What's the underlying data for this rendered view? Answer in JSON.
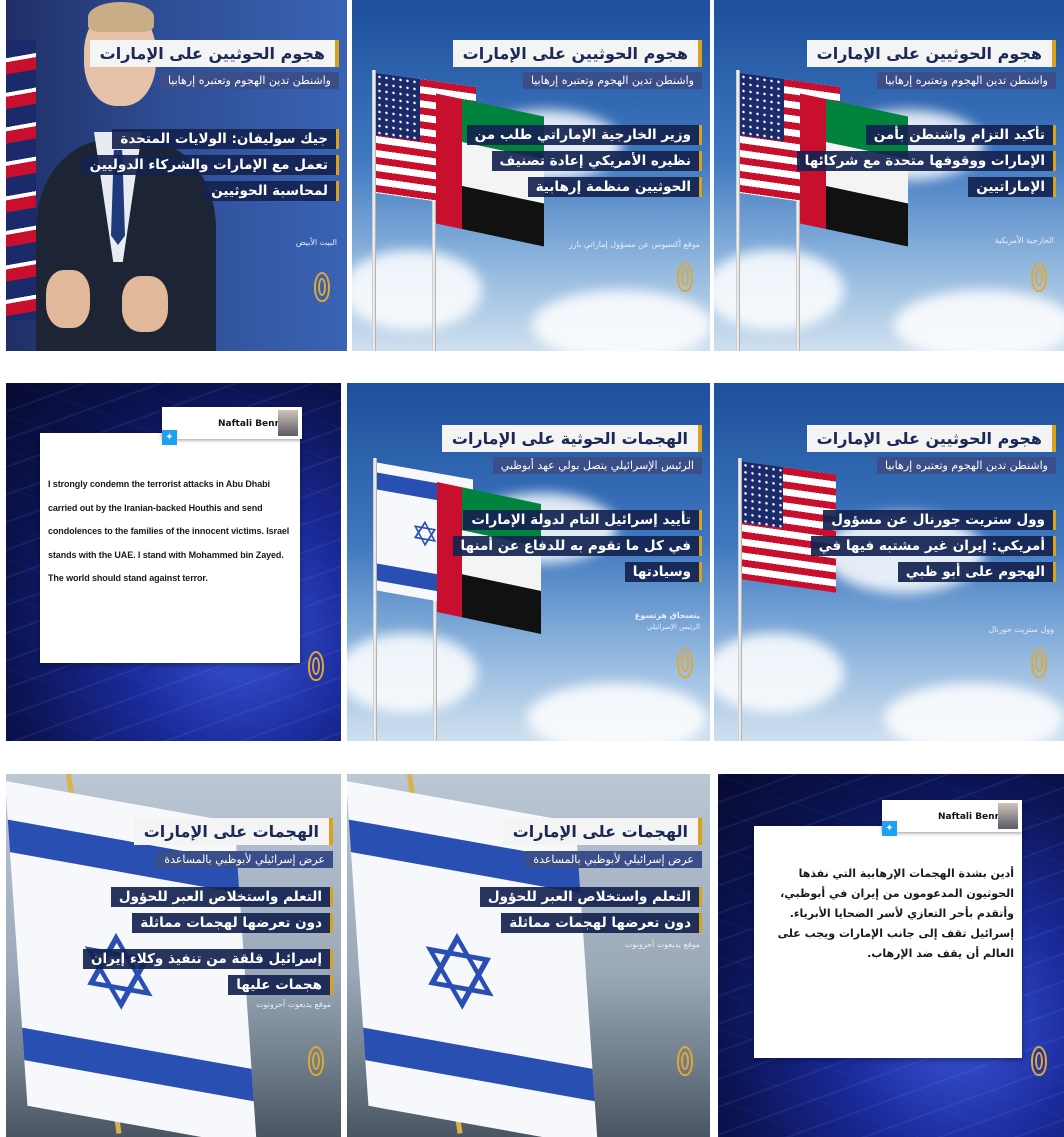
{
  "panels": [
    {
      "title": "هجوم الحوثيين على الإمارات",
      "subtitle": "واشنطن تدين الهجوم وتعتبره إرهابيا",
      "body": [
        "جيك سوليفان: الولايات المتحدة",
        "تعمل مع الإمارات والشركاء الدوليين",
        "لمحاسبة الحوثيين"
      ],
      "source": "البيت الأبيض"
    },
    {
      "title": "هجوم الحوثيين على الإمارات",
      "subtitle": "واشنطن تدين الهجوم وتعتبره إرهابيا",
      "body": [
        "وزير الخارجية الإماراتي طلب من",
        "نظيره الأمريكي إعادة تصنيف",
        "الحوثيين منظمة إرهابية"
      ],
      "source": "موقع أكسيوس عن مسؤول إماراتي بارز"
    },
    {
      "title": "هجوم الحوثيين على الإمارات",
      "subtitle": "واشنطن تدين الهجوم وتعتبره إرهابيا",
      "body": [
        "تأكيد التزام واشنطن بأمن",
        "الإمارات ووقوفها متحدة مع شركائها",
        "الإماراتيين"
      ],
      "source": "الخارجية الأمريكية"
    },
    {
      "tweet_name": "Naftali Bennett",
      "tweet_text": "I strongly condemn the terrorist attacks in Abu Dhabi carried out by the Iranian-backed Houthis and send condolences to the families of the innocent victims.   Israel stands with the UAE.  I stand with Mohammed bin Zayed. The world should stand against terror."
    },
    {
      "title": "الهجمات الحوثية على الإمارات",
      "subtitle": "الرئيس الإسرائيلي يتصل بولي عهد أبوظبي",
      "body": [
        "تأييد إسرائيل التام لدولة الإمارات",
        "في كل ما تقوم به للدفاع عن أمنها",
        "وسيادتها"
      ],
      "source": "يتسحاق هرتسوغ",
      "source2": "الرئيس الإسرائيلي"
    },
    {
      "title": "هجوم الحوثيين على الإمارات",
      "subtitle": "واشنطن تدين الهجوم وتعتبره إرهابيا",
      "body": [
        "وول ستريت جورنال عن مسؤول",
        "أمريكي: إيران غير مشتبه فيها في",
        "الهجوم على أبو ظبي"
      ],
      "source": "وول ستريت جورنال"
    },
    {
      "title": "الهجمات على الإمارات",
      "subtitle": "عرض إسرائيلي لأبوظبي بالمساعدة",
      "body": [
        "التعلم واستخلاص العبر للحؤول",
        "دون تعرضها لهجمات مماثلة"
      ],
      "body2": [
        "إسرائيل قلقة من تنفيذ وكلاء إيران",
        "هجمات عليها"
      ],
      "source": "موقع يديعوت أحرونوت"
    },
    {
      "title": "الهجمات على الإمارات",
      "subtitle": "عرض إسرائيلي لأبوظبي بالمساعدة",
      "body": [
        "التعلم واستخلاص العبر للحؤول",
        "دون تعرضها لهجمات مماثلة"
      ],
      "source": "موقع يديعوت أحرونوت"
    },
    {
      "tweet_name": "Naftali Bennett",
      "tweet_text": "أدين بشدة الهجمات الإرهابية التي نفذها الحوثيون المدعومون من إيران في أبوظبي، وأتقدم بأحر التعازي لأسر الضحايا الأبرياء. إسرائيل تقف إلى جانب الإمارات ويجب على العالم أن يقف ضد الإرهاب."
    }
  ],
  "icons": {
    "logo": "al-jazeera-logo-icon",
    "twitter": "twitter-bird-icon"
  },
  "colors": {
    "title_accent": "#d8a21c",
    "caption_bg": "#142350",
    "news_blue": "#1a2a9a"
  }
}
